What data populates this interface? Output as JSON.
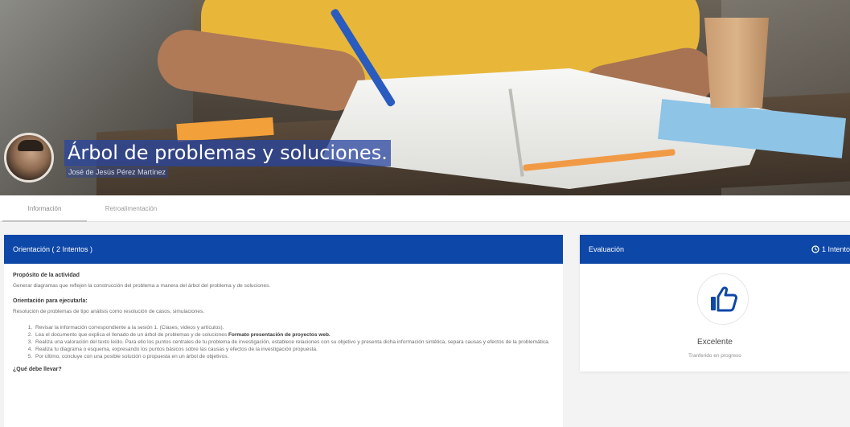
{
  "header": {
    "title": "Árbol de problemas y soluciones.",
    "author": "José de Jesús Pérez Martínez"
  },
  "tabs": [
    {
      "label": "Información",
      "active": true
    },
    {
      "label": "Retroalimentación",
      "active": false
    }
  ],
  "orientation": {
    "heading": "Orientación ( 2 Intentos )",
    "purpose_title": "Propósito de la actividad",
    "purpose_text": "Generar diagramas que reflejen la construcción del problema a manera del árbol del problema y de soluciones.",
    "howto_title": "Orientación para ejecutarla:",
    "howto_text": "Resolución de problemas de tipo análisis como resolución de casos, simulaciones.",
    "steps": [
      "Revisar la información correspondiente a la sesión 1. (Clases, videos y artículos).",
      "Lea el documento que explica el llenado de un árbol de problemas y de soluciones",
      "Realiza una valoración del texto leído. Para ello los puntos centrales de tu problema de investigación, establece relaciones con su objetivo y presenta dicha información sintética, separa causas y efectos de la problemática.",
      "Realiza tu diagrama o esquema, expresando los puntos básicos sobre las causas y efectos de la investigación propuesta.",
      "Por último, concluye con una posible solución o propuesta en un árbol de objetivos."
    ],
    "step2_bold": "Formato presentación de proyectos web.",
    "deliver_title": "¿Qué debe llevar?"
  },
  "evaluation": {
    "heading": "Evaluación",
    "attempts": "1 Intento",
    "grade": "Excelente",
    "status": "Tranferido en progreso"
  },
  "colors": {
    "primary": "#0d47a8",
    "background": "#f3f3f3"
  }
}
